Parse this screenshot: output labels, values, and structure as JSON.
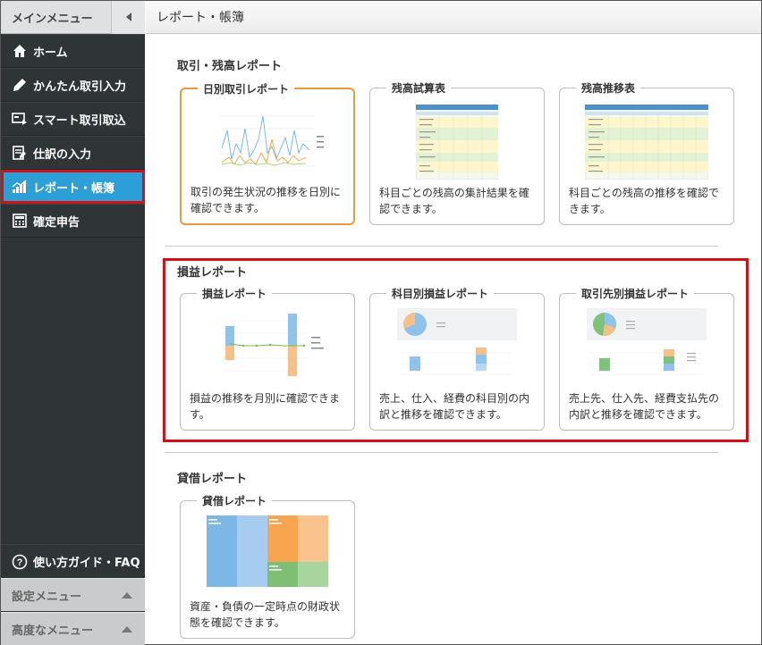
{
  "sidebar": {
    "header_title": "メインメニュー",
    "items": [
      {
        "label": "ホーム",
        "icon": "home-icon"
      },
      {
        "label": "かんたん取引入力",
        "icon": "pencil-icon"
      },
      {
        "label": "スマート取引取込",
        "icon": "import-icon"
      },
      {
        "label": "仕訳の入力",
        "icon": "journal-icon"
      },
      {
        "label": "レポート・帳簿",
        "icon": "report-chart-icon"
      },
      {
        "label": "確定申告",
        "icon": "calculator-icon"
      }
    ],
    "guide_label": "使い方ガイド・FAQ",
    "settings_label": "設定メニュー",
    "advanced_label": "高度なメニュー"
  },
  "header": {
    "title": "レポート・帳簿"
  },
  "sections": {
    "trade": {
      "title": "取引・残高レポート",
      "cards": [
        {
          "title": "日別取引レポート",
          "desc": "取引の発生状況の推移を日別に確認できます。"
        },
        {
          "title": "残高試算表",
          "desc": "科目ごとの残高の集計結果を確認できます。"
        },
        {
          "title": "残高推移表",
          "desc": "科目ごとの残高の推移を確認できます。"
        }
      ]
    },
    "pl": {
      "title": "損益レポート",
      "cards": [
        {
          "title": "損益レポート",
          "desc": "損益の推移を月別に確認できます。"
        },
        {
          "title": "科目別損益レポート",
          "desc": "売上、仕入、経費の科目別の内訳と推移を確認できます。"
        },
        {
          "title": "取引先別損益レポート",
          "desc": "売上先、仕入先、経費支払先の内訳と推移を確認できます。"
        }
      ]
    },
    "bs": {
      "title": "貸借レポート",
      "cards": [
        {
          "title": "貸借レポート",
          "desc": "資産・負債の一定時点の財政状態を確認できます。"
        }
      ]
    }
  },
  "colors": {
    "accent": "#2b9fd6",
    "highlight": "#d0111a",
    "selected": "#e79b3b",
    "sidebar": "#2f3437"
  }
}
